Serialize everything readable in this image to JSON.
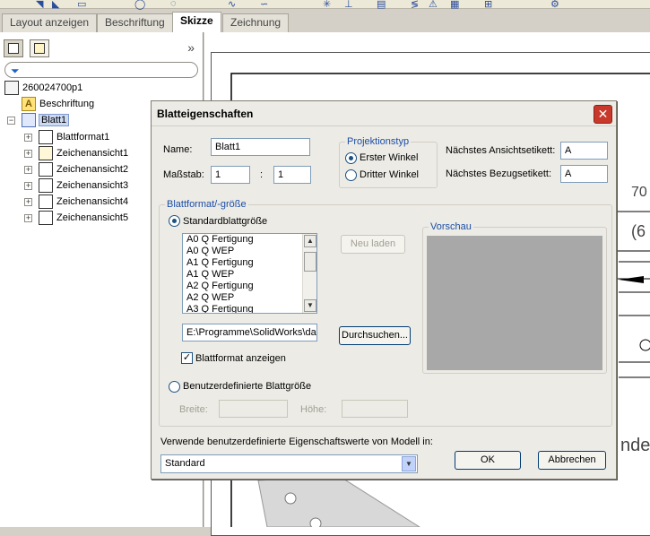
{
  "tabs": [
    "Layout anzeigen",
    "Beschriftung",
    "Skizze",
    "Zeichnung"
  ],
  "active_tab": "Skizze",
  "tree": {
    "root": "260024700p1",
    "annotation": "Beschriftung",
    "sheet": "Blatt1",
    "children": [
      "Blattformat1",
      "Zeichenansicht1",
      "Zeichenansicht2",
      "Zeichenansicht3",
      "Zeichenansicht4",
      "Zeichenansicht5"
    ]
  },
  "drawing": {
    "dim1": "70",
    "dim2": "(6",
    "text1": "nde"
  },
  "dialog": {
    "title": "Blatteigenschaften",
    "name_label": "Name:",
    "name_value": "Blatt1",
    "scale_label": "Maßstab:",
    "scale_num": "1",
    "scale_sep": ":",
    "scale_den": "1",
    "projection": {
      "label": "Projektionstyp",
      "option1": "Erster Winkel",
      "option2": "Dritter Winkel",
      "selected": "Erster Winkel"
    },
    "next_view_label": "Nächstes Ansichtsetikett:",
    "next_view_value": "A",
    "next_ref_label": "Nächstes Bezugsetikett:",
    "next_ref_value": "A",
    "format_group_label": "Blattformat/-größe",
    "standard_label": "Standardblattgröße",
    "sizes": [
      "A0 Q Fertigung",
      "A0 Q WEP",
      "A1 Q Fertigung",
      "A1 Q WEP",
      "A2 Q Fertigung",
      "A2 Q WEP",
      "A3 Q Fertigung"
    ],
    "reload_label": "Neu laden",
    "preview_label": "Vorschau",
    "path_value": "E:\\Programme\\SolidWorks\\da",
    "browse_label": "Durchsuchen...",
    "show_format_label": "Blattformat anzeigen",
    "show_format_checked": true,
    "custom_label": "Benutzerdefinierte Blattgröße",
    "width_label": "Breite:",
    "height_label": "Höhe:",
    "model_props_label": "Verwende benutzerdefinierte Eigenschaftswerte von Modell in:",
    "model_props_value": "Standard",
    "ok_label": "OK",
    "cancel_label": "Abbrechen"
  },
  "colors": {
    "accent": "#1c4ea8",
    "close": "#c8392b",
    "preview": "#a8a8a8"
  }
}
